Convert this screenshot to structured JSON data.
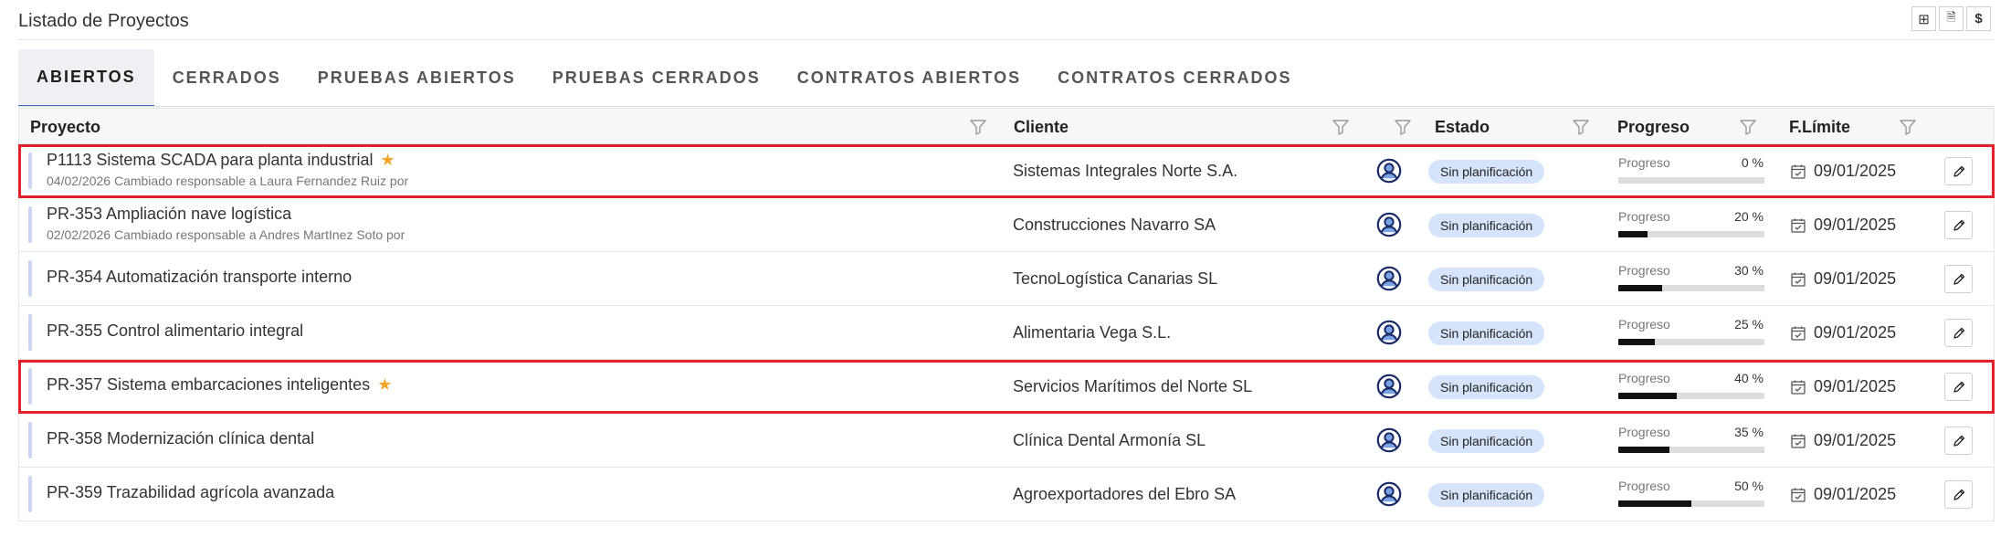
{
  "page": {
    "title": "Listado de Proyectos",
    "actions": [
      {
        "icon": "add-box-icon",
        "symbol": "⊞"
      },
      {
        "icon": "document-icon",
        "symbol": "🗎"
      },
      {
        "icon": "dollar-icon",
        "symbol": "$"
      }
    ]
  },
  "tabs": [
    {
      "label": "ABIERTOS",
      "active": true
    },
    {
      "label": "CERRADOS",
      "active": false
    },
    {
      "label": "PRUEBAS ABIERTOS",
      "active": false
    },
    {
      "label": "PRUEBAS CERRADOS",
      "active": false
    },
    {
      "label": "CONTRATOS ABIERTOS",
      "active": false
    },
    {
      "label": "CONTRATOS CERRADOS",
      "active": false
    }
  ],
  "columns": {
    "proyecto": "Proyecto",
    "cliente": "Cliente",
    "estado": "Estado",
    "progreso": "Progreso",
    "flimite": "F.Límite"
  },
  "rows": [
    {
      "name": "P1113 Sistema SCADA para planta industrial",
      "starred": true,
      "highlighted": true,
      "subtitle": "04/02/2026 Cambiado responsable a Laura Fernandez Ruiz por",
      "client": "Sistemas Integrales Norte S.A.",
      "status": "Sin planificación",
      "progress_label": "Progreso",
      "progress": 0,
      "progress_text": "0 %",
      "deadline": "09/01/2025"
    },
    {
      "name": "PR-353 Ampliación nave logística",
      "starred": false,
      "highlighted": false,
      "subtitle": "02/02/2026 Cambiado responsable a Andres MartInez Soto por",
      "client": "Construcciones Navarro SA",
      "status": "Sin planificación",
      "progress_label": "Progreso",
      "progress": 20,
      "progress_text": "20 %",
      "deadline": "09/01/2025"
    },
    {
      "name": "PR-354 Automatización transporte interno",
      "starred": false,
      "highlighted": false,
      "subtitle": "",
      "client": "TecnoLogística Canarias SL",
      "status": "Sin planificación",
      "progress_label": "Progreso",
      "progress": 30,
      "progress_text": "30 %",
      "deadline": "09/01/2025"
    },
    {
      "name": "PR-355 Control alimentario integral",
      "starred": false,
      "highlighted": false,
      "subtitle": "",
      "client": "Alimentaria Vega S.L.",
      "status": "Sin planificación",
      "progress_label": "Progreso",
      "progress": 25,
      "progress_text": "25 %",
      "deadline": "09/01/2025"
    },
    {
      "name": "PR-357 Sistema embarcaciones inteligentes",
      "starred": true,
      "highlighted": true,
      "subtitle": "",
      "client": "Servicios Marítimos del Norte SL",
      "status": "Sin planificación",
      "progress_label": "Progreso",
      "progress": 40,
      "progress_text": "40 %",
      "deadline": "09/01/2025"
    },
    {
      "name": "PR-358 Modernización clínica dental",
      "starred": false,
      "highlighted": false,
      "subtitle": "",
      "client": "Clínica Dental Armonía SL",
      "status": "Sin planificación",
      "progress_label": "Progreso",
      "progress": 35,
      "progress_text": "35 %",
      "deadline": "09/01/2025"
    },
    {
      "name": "PR-359 Trazabilidad agrícola avanzada",
      "starred": false,
      "highlighted": false,
      "subtitle": "",
      "client": "Agroexportadores del Ebro SA",
      "status": "Sin planificación",
      "progress_label": "Progreso",
      "progress": 50,
      "progress_text": "50 %",
      "deadline": "09/01/2025"
    }
  ],
  "colors": {
    "highlight": "#e0202a",
    "tab_active_underline": "#3b6ed5",
    "status_badge": "#d6e4fb",
    "row_accent": "#c9d6f4",
    "star": "#f2a52d",
    "avatar": "#1a2a66"
  }
}
